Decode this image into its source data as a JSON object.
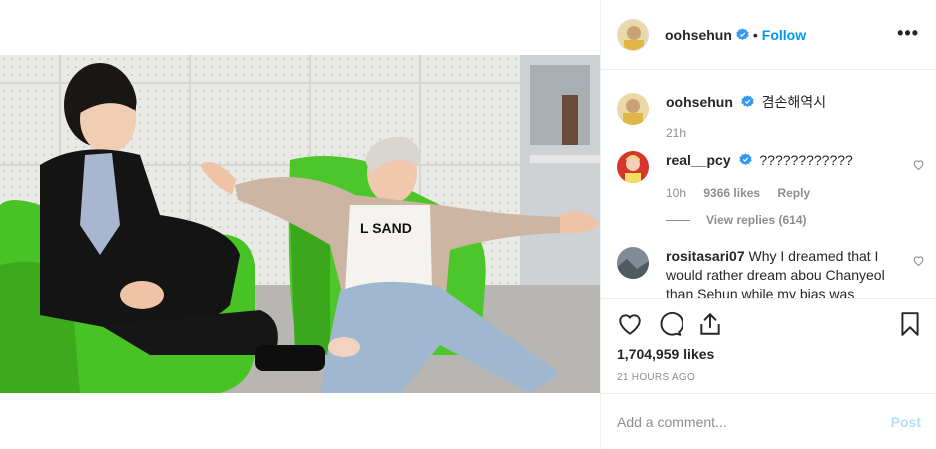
{
  "post": {
    "username": "oohsehun",
    "follow_label": "Follow",
    "dot": "•",
    "more": "•••"
  },
  "comments": [
    {
      "username": "oohsehun",
      "text": "겸손해역시",
      "time": "21h"
    },
    {
      "username": "real__pcy",
      "text": "????????????",
      "time": "10h",
      "likes": "9366 likes",
      "reply": "Reply",
      "view_replies": "View replies (614)"
    },
    {
      "username": "rositasari07",
      "text": "Why I dreamed that I would rather dream abou Chanyeol than Sehun while my bias was"
    }
  ],
  "actions": {
    "likes_count": "1,704,959 likes",
    "time_ago": "21 HOURS AGO"
  },
  "add_comment": {
    "placeholder": "Add a comment...",
    "post_label": "Post"
  },
  "colors": {
    "accent": "#0095f6",
    "post_disabled": "#b2dffc",
    "chair_green": "#4cc62a"
  }
}
